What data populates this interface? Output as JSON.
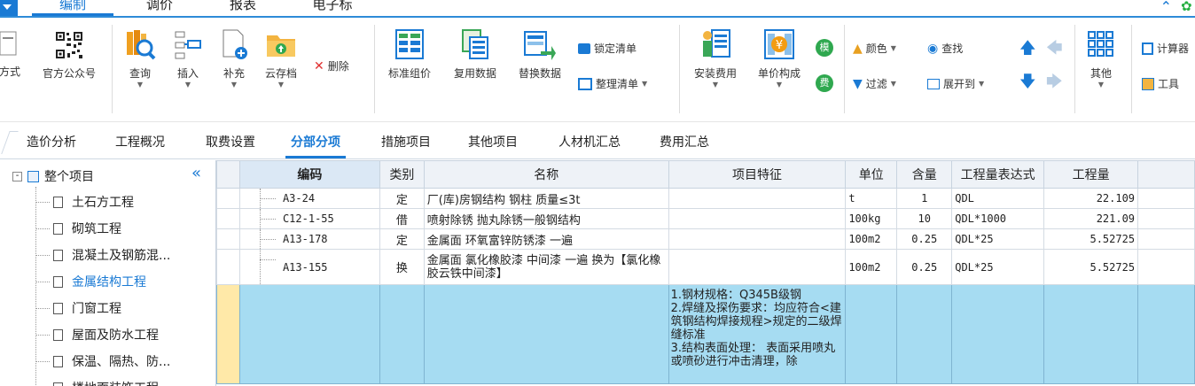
{
  "menu": {
    "tabs": [
      {
        "label": "编制",
        "active": true
      },
      {
        "label": "调价",
        "active": false
      },
      {
        "label": "报表",
        "active": false
      },
      {
        "label": "电子标",
        "active": false
      }
    ],
    "collapse_icon": "chevron-up-icon"
  },
  "ribbon": {
    "fangshi": "方式",
    "official_account": "官方公众号",
    "query": "查询",
    "insert": "插入",
    "supplement": "补充",
    "cloud_save": "云存档",
    "delete": "删除",
    "standard_price": "标准组价",
    "reuse_data": "复用数据",
    "replace_data": "替换数据",
    "lock_list": "锁定清单",
    "organize_list": "整理清单",
    "install_fee": "安装费用",
    "unit_price": "单价构成",
    "color": "颜色",
    "find": "查找",
    "filter": "过滤",
    "expand_to": "展开到",
    "other": "其他",
    "calc": "计算器",
    "tools": "工具",
    "badge_mo": "模",
    "badge_fei": "费"
  },
  "subtabs": [
    {
      "label": "造价分析",
      "active": false
    },
    {
      "label": "工程概况",
      "active": false
    },
    {
      "label": "取费设置",
      "active": false
    },
    {
      "label": "分部分项",
      "active": true
    },
    {
      "label": "措施项目",
      "active": false
    },
    {
      "label": "其他项目",
      "active": false
    },
    {
      "label": "人材机汇总",
      "active": false
    },
    {
      "label": "费用汇总",
      "active": false
    }
  ],
  "tree": {
    "root": "整个项目",
    "items": [
      {
        "label": "土石方工程",
        "active": false
      },
      {
        "label": "砌筑工程",
        "active": false
      },
      {
        "label": "混凝土及钢筋混...",
        "active": false
      },
      {
        "label": "金属结构工程",
        "active": true
      },
      {
        "label": "门窗工程",
        "active": false
      },
      {
        "label": "屋面及防水工程",
        "active": false
      },
      {
        "label": "保温、隔热、防...",
        "active": false
      },
      {
        "label": "楼地面装饰工程",
        "active": false
      }
    ]
  },
  "table": {
    "headers": [
      "编码",
      "类别",
      "名称",
      "项目特征",
      "单位",
      "含量",
      "工程量表达式",
      "工程量"
    ],
    "rows": [
      {
        "code": "A3-24",
        "type": "定",
        "name": "厂(库)房钢结构 钢柱 质量≤3t",
        "feature": "",
        "unit": "t",
        "content": "1",
        "expr": "QDL",
        "qty": "22.109"
      },
      {
        "code": "C12-1-55",
        "type": "借",
        "name": "喷射除锈 抛丸除锈一般钢结构",
        "feature": "",
        "unit": "100kg",
        "content": "10",
        "expr": "QDL*1000",
        "qty": "221.09"
      },
      {
        "code": "A13-178",
        "type": "定",
        "name": "金属面 环氧富锌防锈漆 一遍",
        "feature": "",
        "unit": "100m2",
        "content": "0.25",
        "expr": "QDL*25",
        "qty": "5.52725"
      },
      {
        "code": "A13-155",
        "type": "换",
        "name": "金属面 氯化橡胶漆 中间漆 一遍  换为【氯化橡胶云铁中间漆】",
        "feature": "",
        "unit": "100m2",
        "content": "0.25",
        "expr": "QDL*25",
        "qty": "5.52725"
      }
    ],
    "selected_feature": "1.钢材规格：Q345B级钢\n2.焊缝及探伤要求：均应符合<建筑钢结构焊接规程>规定的二级焊缝标准\n3.结构表面处理： 表面采用喷丸或喷砂进行冲击清理，除"
  }
}
